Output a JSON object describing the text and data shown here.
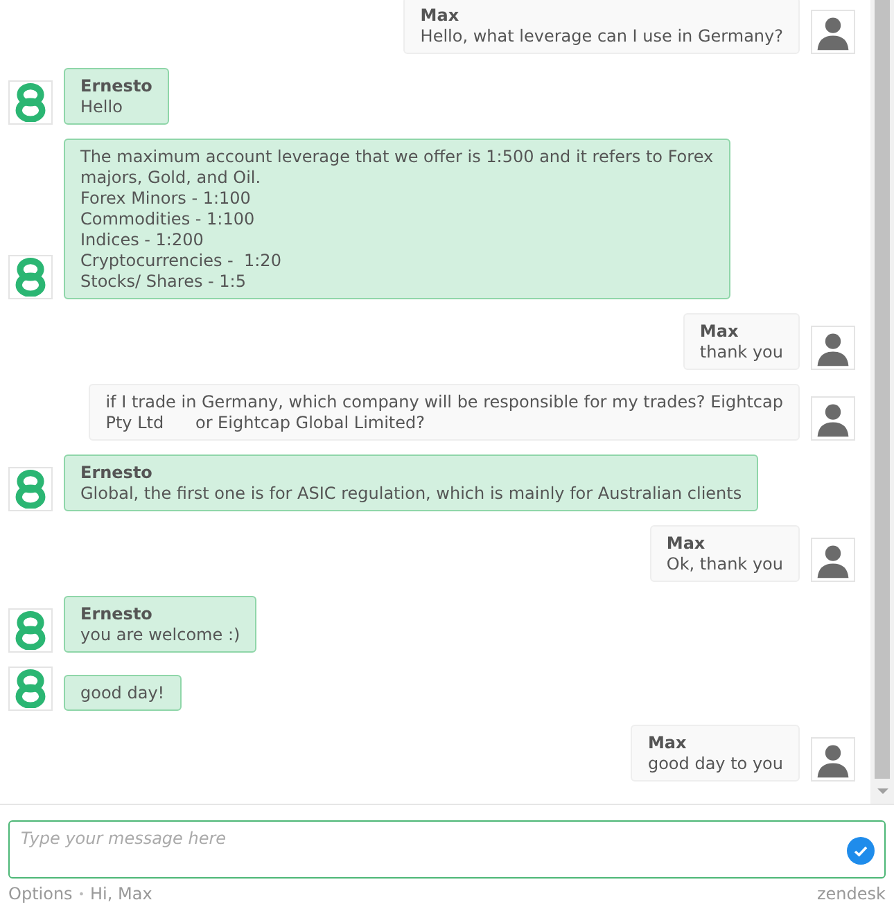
{
  "messages": [
    {
      "kind": "visitor",
      "name": "Max",
      "text": "Hello, what leverage can I use in Germany?"
    },
    {
      "kind": "agent",
      "name": "Ernesto",
      "text": "Hello"
    },
    {
      "kind": "agent",
      "text": "The maximum account leverage that we offer is 1:500 and it refers to Forex\nmajors, Gold, and Oil.\nForex Minors - 1:100\nCommodities - 1:100\nIndices - 1:200\nCryptocurrencies -  1:20\nStocks/ Shares - 1:5"
    },
    {
      "kind": "visitor",
      "name": "Max",
      "text": "thank you"
    },
    {
      "kind": "visitor",
      "text": "if I trade in Germany, which company will be responsible for my trades? Eightcap\nPty Ltd      or Eightcap Global Limited?"
    },
    {
      "kind": "agent",
      "name": "Ernesto",
      "text": "Global, the first one is for ASIC regulation, which is mainly for Australian clients"
    },
    {
      "kind": "visitor",
      "name": "Max",
      "text": "Ok, thank you"
    },
    {
      "kind": "agent",
      "name": "Ernesto",
      "text": "you are welcome :)"
    },
    {
      "kind": "agent",
      "text": "good day!"
    },
    {
      "kind": "visitor",
      "name": "Max",
      "text": "good day to you"
    }
  ],
  "composer": {
    "placeholder": "Type your message here"
  },
  "footer": {
    "options": "Options",
    "separator": "•",
    "greeting": "Hi, Max",
    "brand": "zendesk"
  }
}
